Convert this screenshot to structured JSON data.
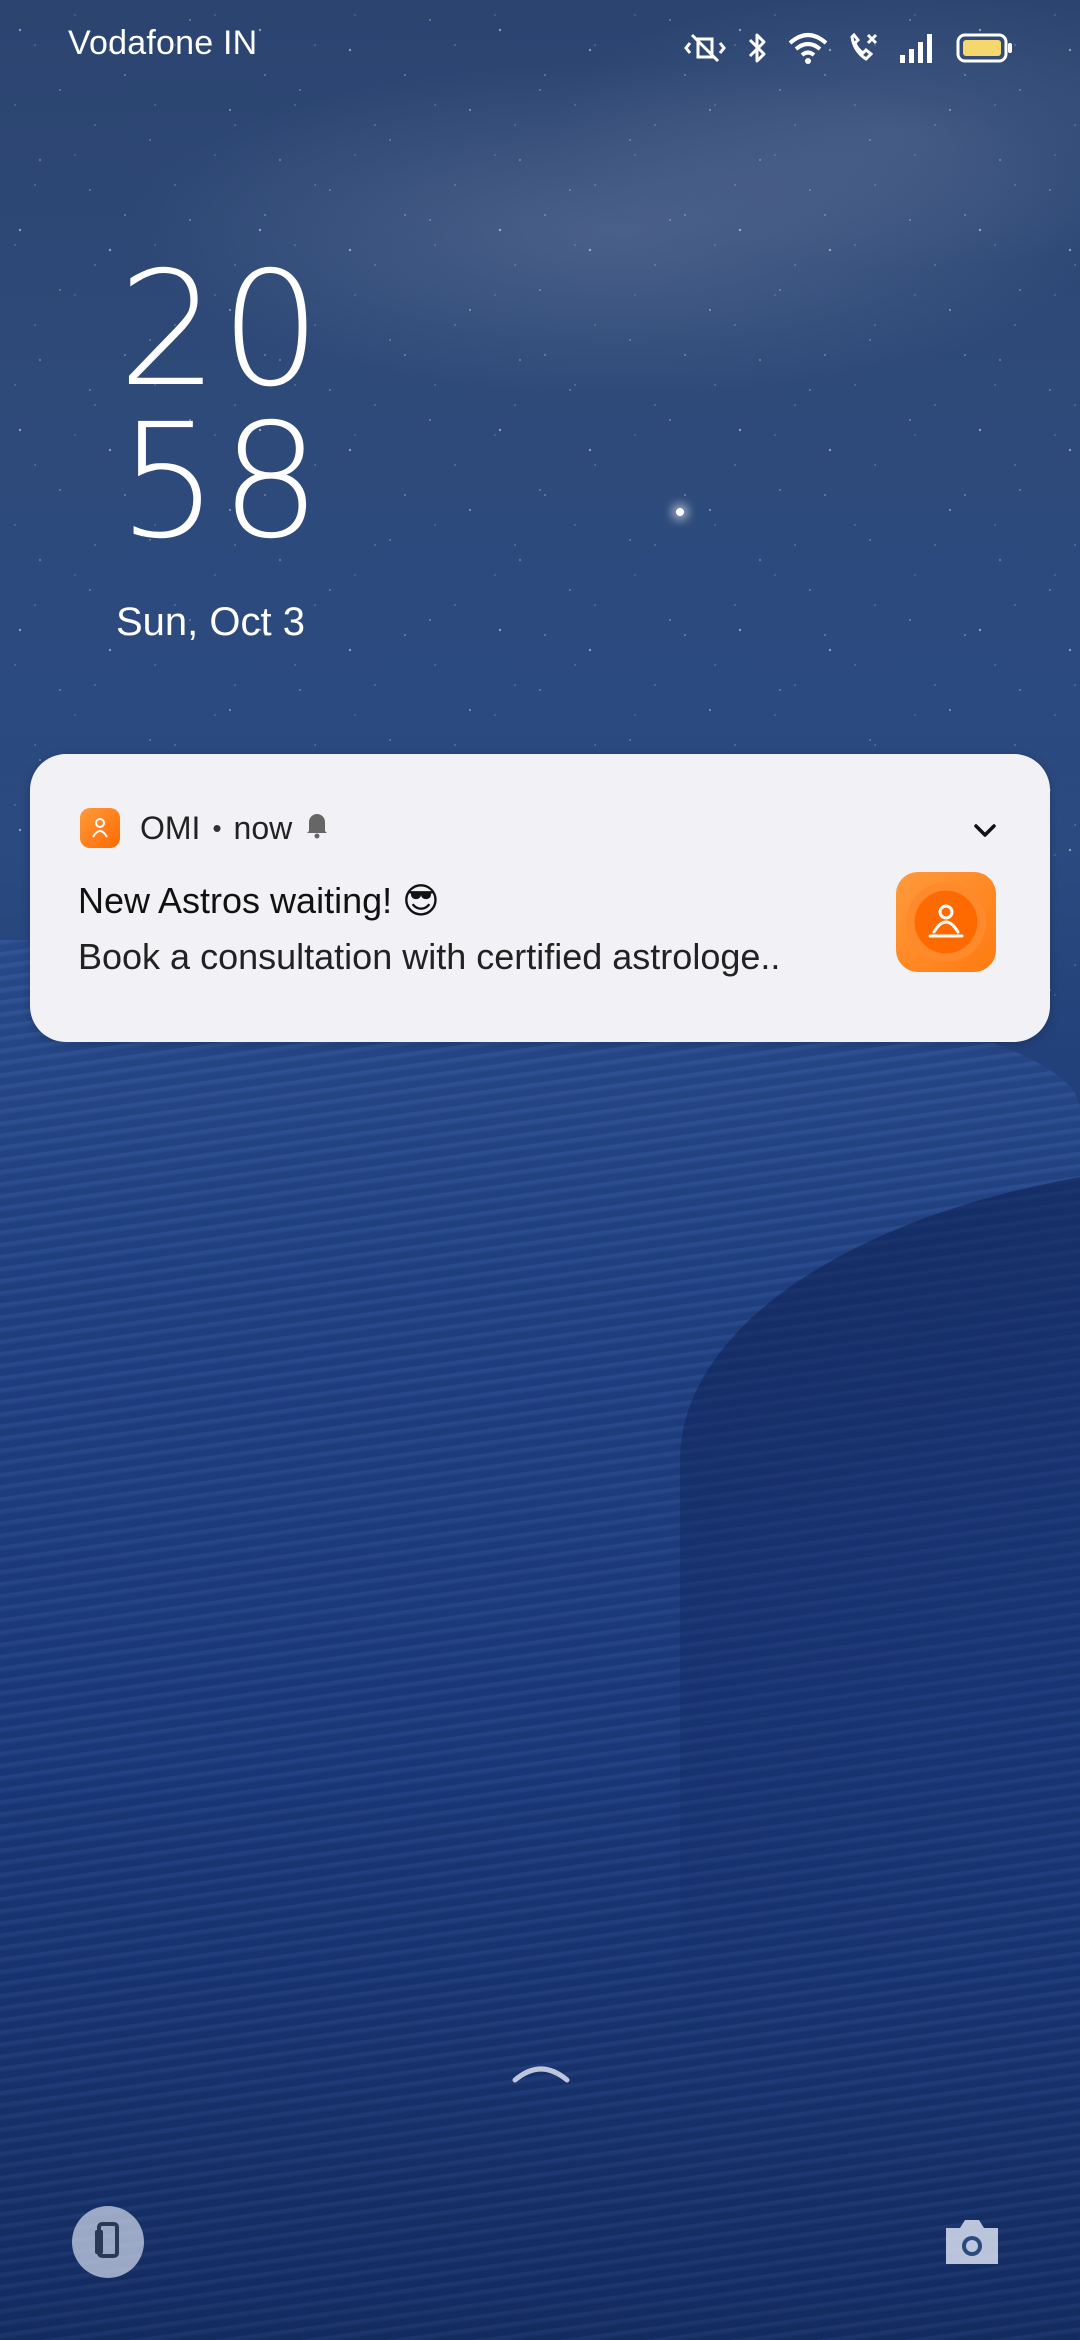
{
  "status_bar": {
    "carrier": "Vodafone IN",
    "icons": [
      "vibrate-icon",
      "bluetooth-icon",
      "wifi-icon",
      "call-icon",
      "signal-icon",
      "battery-icon"
    ],
    "battery_color": "#f5d76e"
  },
  "lockscreen": {
    "clock_hours": "20",
    "clock_minutes": "58",
    "date": "Sun, Oct 3"
  },
  "notification": {
    "app_name": "OMI",
    "separator": "•",
    "time": "now",
    "title": "New Astros waiting! 😎",
    "body": "Book a consultation with certified astrologe..",
    "accent_color": "#ff7a10"
  },
  "bottom": {
    "left_icon": "phone-icon",
    "right_icon": "camera-icon",
    "swipe_icon": "chevron-up-icon"
  }
}
